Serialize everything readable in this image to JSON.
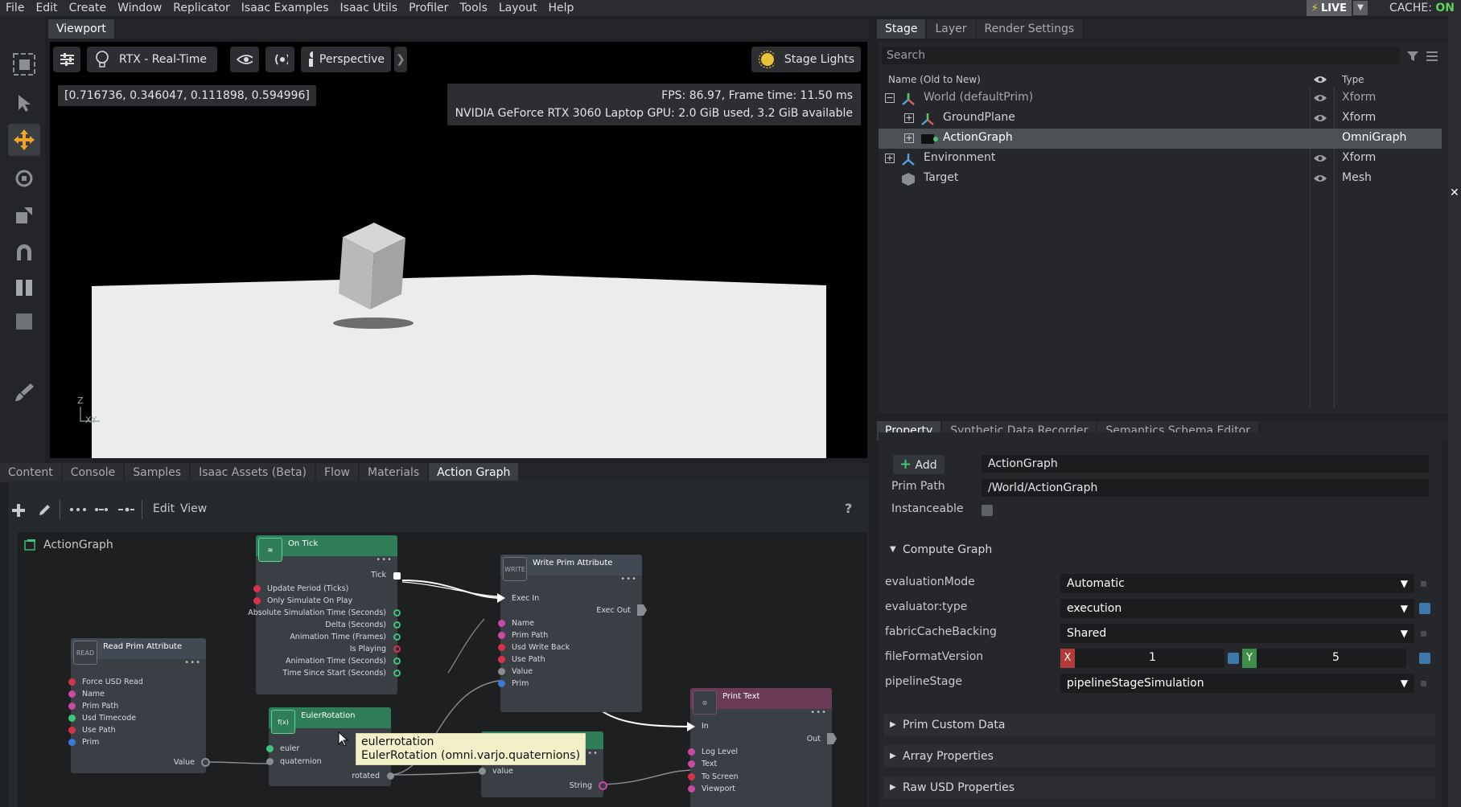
{
  "menubar": {
    "items": [
      "File",
      "Edit",
      "Create",
      "Window",
      "Replicator",
      "Isaac Examples",
      "Isaac Utils",
      "Profiler",
      "Tools",
      "Layout",
      "Help"
    ],
    "live_label": "LIVE",
    "cache_label": "CACHE:",
    "cache_state": "ON"
  },
  "viewport": {
    "tab_label": "Viewport",
    "renderer_label": "RTX - Real-Time",
    "camera_label": "Perspective",
    "lights_label": "Stage Lights",
    "coords": "[0.716736, 0.346047, 0.111898, 0.594996]",
    "fps_line": "FPS: 86.97, Frame time: 11.50 ms",
    "gpu_line": "NVIDIA GeForce RTX 3060 Laptop GPU: 2.0 GiB used, 3.2 GiB available",
    "axis_z": "Z",
    "axis_xy": "XY"
  },
  "stage": {
    "tabs": [
      "Stage",
      "Layer",
      "Render Settings"
    ],
    "search_placeholder": "Search",
    "col_name": "Name (Old to New)",
    "col_type": "Type",
    "rows": [
      {
        "name": "World (defaultPrim)",
        "type": "Xform"
      },
      {
        "name": "GroundPlane",
        "type": "Xform"
      },
      {
        "name": "ActionGraph",
        "type": "OmniGraph"
      },
      {
        "name": "Environment",
        "type": "Xform"
      },
      {
        "name": "Target",
        "type": "Mesh"
      }
    ]
  },
  "bottom_tabs": [
    "Content",
    "Console",
    "Samples",
    "Isaac Assets (Beta)",
    "Flow",
    "Materials",
    "Action Graph"
  ],
  "action_graph": {
    "menu_edit": "Edit",
    "menu_view": "View",
    "help": "?",
    "graph_name": "ActionGraph",
    "nodes": {
      "on_tick": {
        "title": "On Tick",
        "pin_tick": "Tick",
        "pins": [
          "Update Period (Ticks)",
          "Only Simulate On Play",
          "Absolute Simulation Time (Seconds)",
          "Delta (Seconds)",
          "Animation Time (Frames)",
          "Is Playing",
          "Animation Time (Seconds)",
          "Time Since Start (Seconds)"
        ]
      },
      "write_prim": {
        "title": "Write Prim Attribute",
        "icon": "WRITE",
        "exec_in": "Exec In",
        "exec_out": "Exec Out",
        "pins": [
          "Name",
          "Prim Path",
          "Usd Write Back",
          "Use Path",
          "Value",
          "Prim"
        ]
      },
      "read_prim": {
        "title": "Read Prim Attribute",
        "icon": "READ",
        "pins": [
          "Force USD Read",
          "Name",
          "Prim Path",
          "Usd Timecode",
          "Use Path",
          "Prim"
        ],
        "out": "Value"
      },
      "euler": {
        "title": "EulerRotation",
        "icon": "f(x)",
        "pins": [
          "euler",
          "quaternion"
        ],
        "out": "rotated"
      },
      "tostring": {
        "in": "value",
        "out": "String"
      },
      "print_text": {
        "title": "Print Text",
        "in": "In",
        "out": "Out",
        "pins": [
          "Log Level",
          "Text",
          "To Screen",
          "Viewport"
        ]
      }
    },
    "tooltip_line1": "eulerrotation",
    "tooltip_line2": "EulerRotation (omni.varjo.quaternions)"
  },
  "property": {
    "tabs": [
      "Property",
      "Synthetic Data Recorder",
      "Semantics Schema Editor"
    ],
    "add_label": "Add",
    "name_value": "ActionGraph",
    "prim_path_label": "Prim Path",
    "prim_path_value": "/World/ActionGraph",
    "instanceable_label": "Instanceable",
    "section_compute": "Compute Graph",
    "fields": {
      "evaluationMode": {
        "label": "evaluationMode",
        "value": "Automatic"
      },
      "evaluatorType": {
        "label": "evaluator:type",
        "value": "execution"
      },
      "fabricCacheBacking": {
        "label": "fabricCacheBacking",
        "value": "Shared"
      },
      "fileFormatVersion": {
        "label": "fileFormatVersion",
        "x_label": "X",
        "x_value": "1",
        "y_label": "Y",
        "y_value": "5"
      },
      "pipelineStage": {
        "label": "pipelineStage",
        "value": "pipelineStageSimulation"
      }
    },
    "sections": [
      "Prim Custom Data",
      "Array Properties",
      "Raw USD Properties"
    ]
  },
  "colors": {
    "accent_green": "#3fc47a",
    "selection": "#4d5156",
    "exec_node_header": "#2f7d59",
    "print_node_header": "#6b3a57"
  }
}
